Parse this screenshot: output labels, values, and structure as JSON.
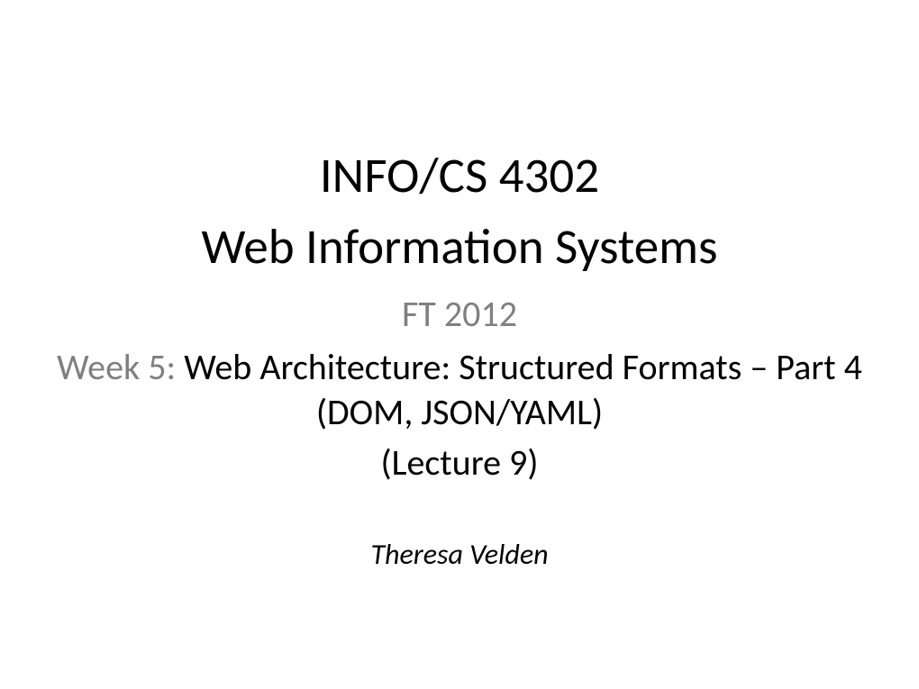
{
  "slide": {
    "course_code": "INFO/CS 4302",
    "course_title": "Web Information Systems",
    "term": "FT 2012",
    "week_label": "Week 5: ",
    "topic": "Web Architecture: Structured Formats – Part 4 (DOM, JSON/YAML)",
    "lecture_number": "(Lecture 9)",
    "author": "Theresa Velden"
  }
}
